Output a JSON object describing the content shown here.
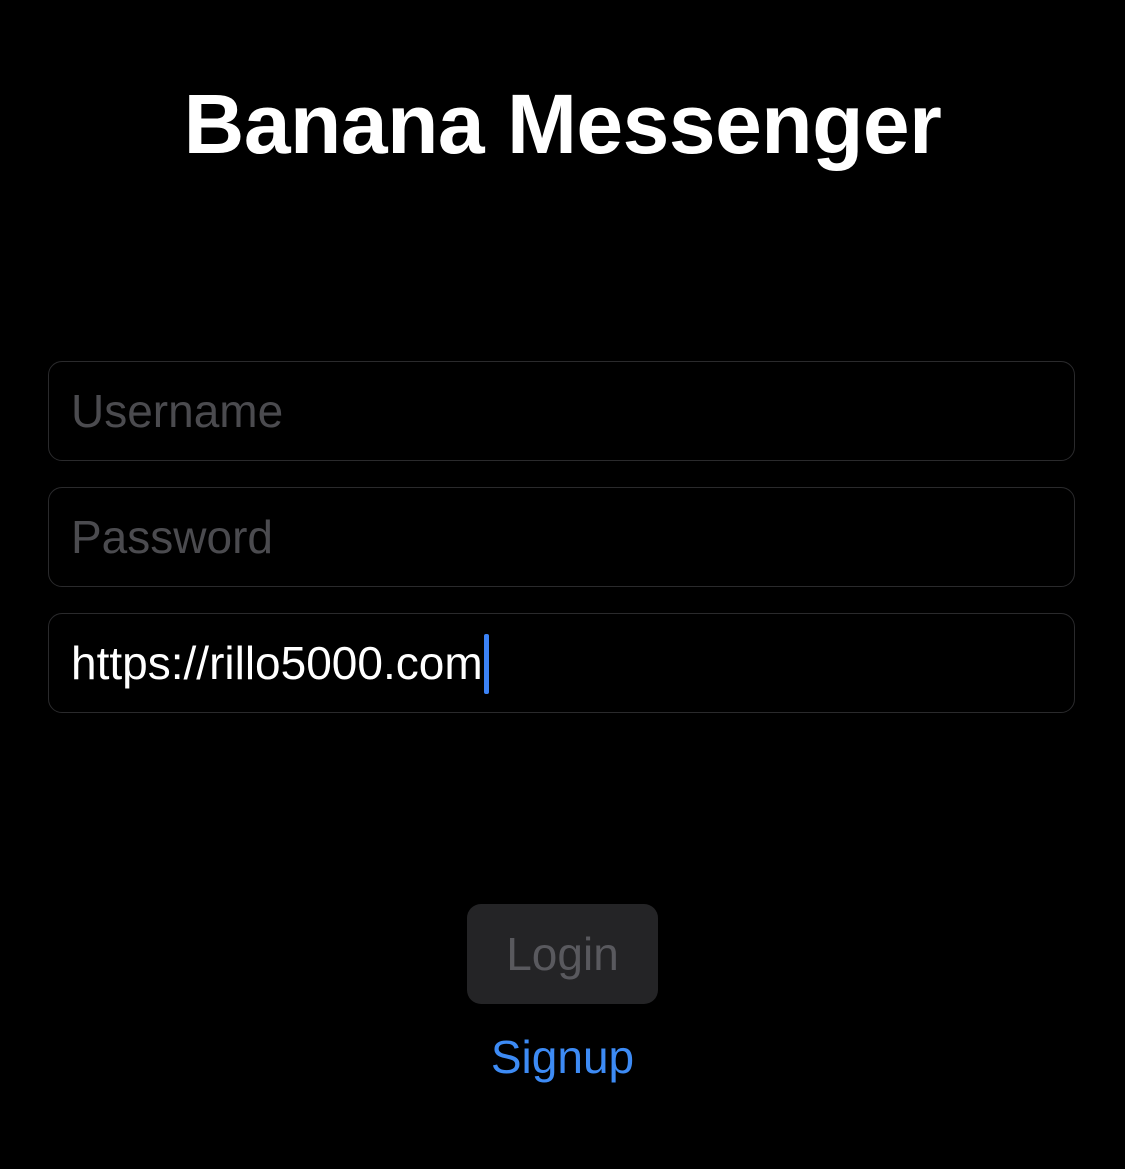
{
  "app": {
    "title": "Banana Messenger"
  },
  "form": {
    "username": {
      "value": "",
      "placeholder": "Username"
    },
    "password": {
      "value": "",
      "placeholder": "Password"
    },
    "server": {
      "value": "https://rillo5000.com",
      "placeholder": ""
    },
    "login_label": "Login",
    "login_enabled": false,
    "signup_label": "Signup"
  },
  "colors": {
    "background": "#000000",
    "accent": "#3d8bf5",
    "field_border": "#2a2a2c",
    "placeholder": "#4b4b4f",
    "button_disabled_bg": "#242426",
    "button_disabled_text": "#59595e"
  }
}
